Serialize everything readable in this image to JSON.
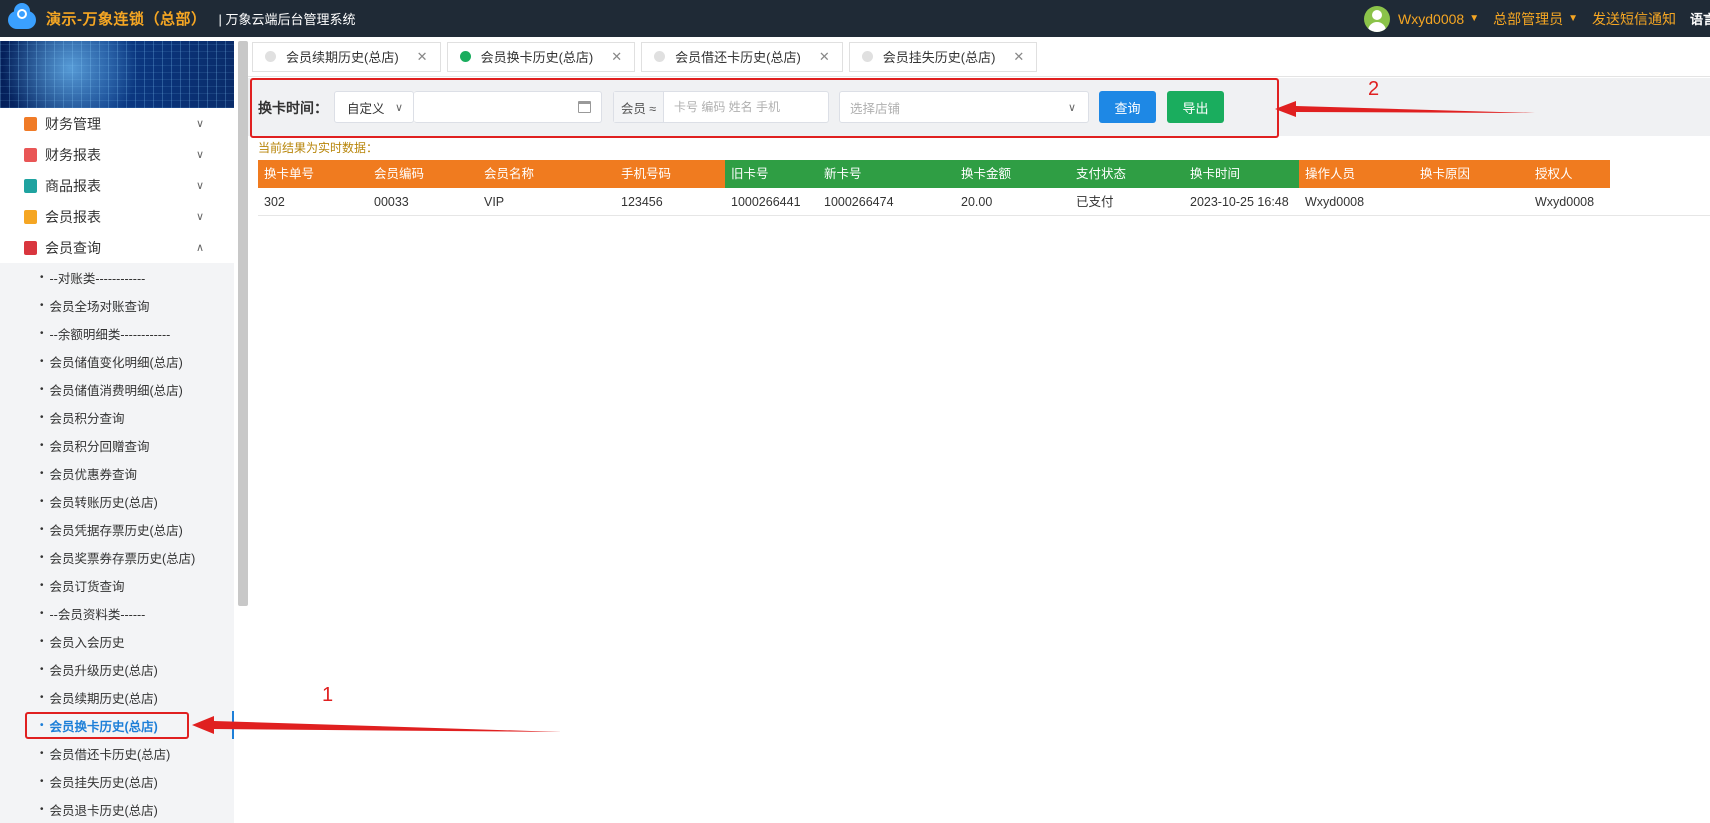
{
  "header": {
    "brand": "演示-万象连锁（总部）",
    "system_name": "| 万象云端后台管理系统",
    "username": "Wxyd0008",
    "role": "总部管理员",
    "sms_link": "发送短信通知",
    "lang": "语言"
  },
  "sidebar": {
    "groups": [
      {
        "label": "财务管理",
        "icon_color": "#f07b27",
        "expanded": false
      },
      {
        "label": "财务报表",
        "icon_color": "#e95656",
        "expanded": false
      },
      {
        "label": "商品报表",
        "icon_color": "#1fa3a0",
        "expanded": false
      },
      {
        "label": "会员报表",
        "icon_color": "#f5a623",
        "expanded": false
      },
      {
        "label": "会员查询",
        "icon_color": "#d9363e",
        "expanded": true
      }
    ],
    "member_query_items": [
      "--对账类------------",
      "会员全场对账查询",
      "--余额明细类------------",
      "会员储值变化明细(总店)",
      "会员储值消费明细(总店)",
      "会员积分查询",
      "会员积分回赠查询",
      "会员优惠券查询",
      "会员转账历史(总店)",
      "会员凭据存票历史(总店)",
      "会员奖票券存票历史(总店)",
      "会员订货查询",
      "--会员资料类------",
      "会员入会历史",
      "会员升级历史(总店)",
      "会员续期历史(总店)",
      "会员换卡历史(总店)",
      "会员借还卡历史(总店)",
      "会员挂失历史(总店)",
      "会员退卡历史(总店)"
    ],
    "active_item": "会员换卡历史(总店)"
  },
  "tabs": [
    {
      "label": "会员续期历史(总店)",
      "active": false
    },
    {
      "label": "会员换卡历史(总店)",
      "active": true
    },
    {
      "label": "会员借还卡历史(总店)",
      "active": false
    },
    {
      "label": "会员挂失历史(总店)",
      "active": false
    }
  ],
  "filter": {
    "time_label": "换卡时间：",
    "time_mode": "自定义",
    "date_value": "",
    "member_label": "会员 ≈",
    "member_placeholder": "卡号 编码 姓名 手机",
    "store_placeholder": "选择店铺",
    "query_button": "查询",
    "export_button": "导出"
  },
  "realtime_note": "当前结果为实时数据：",
  "table": {
    "columns": [
      {
        "label": "换卡单号",
        "color": "#f07b1f"
      },
      {
        "label": "会员编码",
        "color": "#f07b1f"
      },
      {
        "label": "会员名称",
        "color": "#f07b1f"
      },
      {
        "label": "手机号码",
        "color": "#f07b1f"
      },
      {
        "label": "旧卡号",
        "color": "#2f9e44"
      },
      {
        "label": "新卡号",
        "color": "#2f9e44"
      },
      {
        "label": "换卡金额",
        "color": "#2f9e44"
      },
      {
        "label": "支付状态",
        "color": "#2f9e44"
      },
      {
        "label": "换卡时间",
        "color": "#2f9e44"
      },
      {
        "label": "操作人员",
        "color": "#f07b1f"
      },
      {
        "label": "换卡原因",
        "color": "#f07b1f"
      },
      {
        "label": "授权人",
        "color": "#f07b1f"
      }
    ],
    "rows": [
      [
        "302",
        "00033",
        "VIP",
        "123456",
        "1000266441",
        "1000266474",
        "20.00",
        "已支付",
        "2023-10-25 16:48",
        "Wxyd0008",
        "",
        "Wxyd0008"
      ]
    ]
  },
  "annotations": {
    "label_1": "1",
    "label_2": "2",
    "color": "#e02020"
  }
}
